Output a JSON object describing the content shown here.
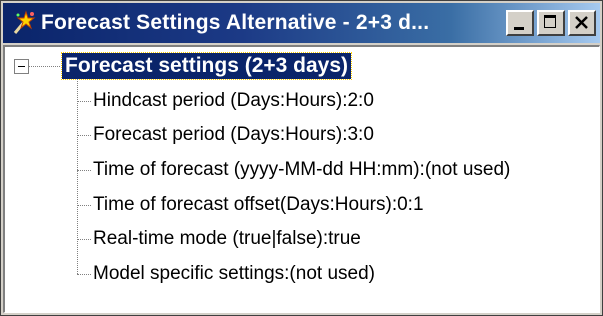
{
  "window": {
    "title": "Forecast Settings Alternative - 2+3 d...",
    "icon": "wand-sparkle-icon"
  },
  "controls": {
    "minimize_icon": "minimize-icon",
    "maximize_icon": "maximize-icon",
    "close_icon": "close-icon"
  },
  "tree": {
    "root_label": "Forecast settings (2+3 days)",
    "root_expanded": true,
    "items": [
      {
        "label": "Hindcast period (Days:Hours):2:0"
      },
      {
        "label": "Forecast period (Days:Hours):3:0"
      },
      {
        "label": "Time of forecast (yyyy-MM-dd HH:mm):(not used)"
      },
      {
        "label": "Time of forecast offset(Days:Hours):0:1"
      },
      {
        "label": "Real-time mode (true|false):true"
      },
      {
        "label": "Model specific settings:(not used)"
      }
    ]
  },
  "colors": {
    "titlebar_start": "#0a246a",
    "titlebar_end": "#a6caf0",
    "selection": "#0a246a"
  }
}
